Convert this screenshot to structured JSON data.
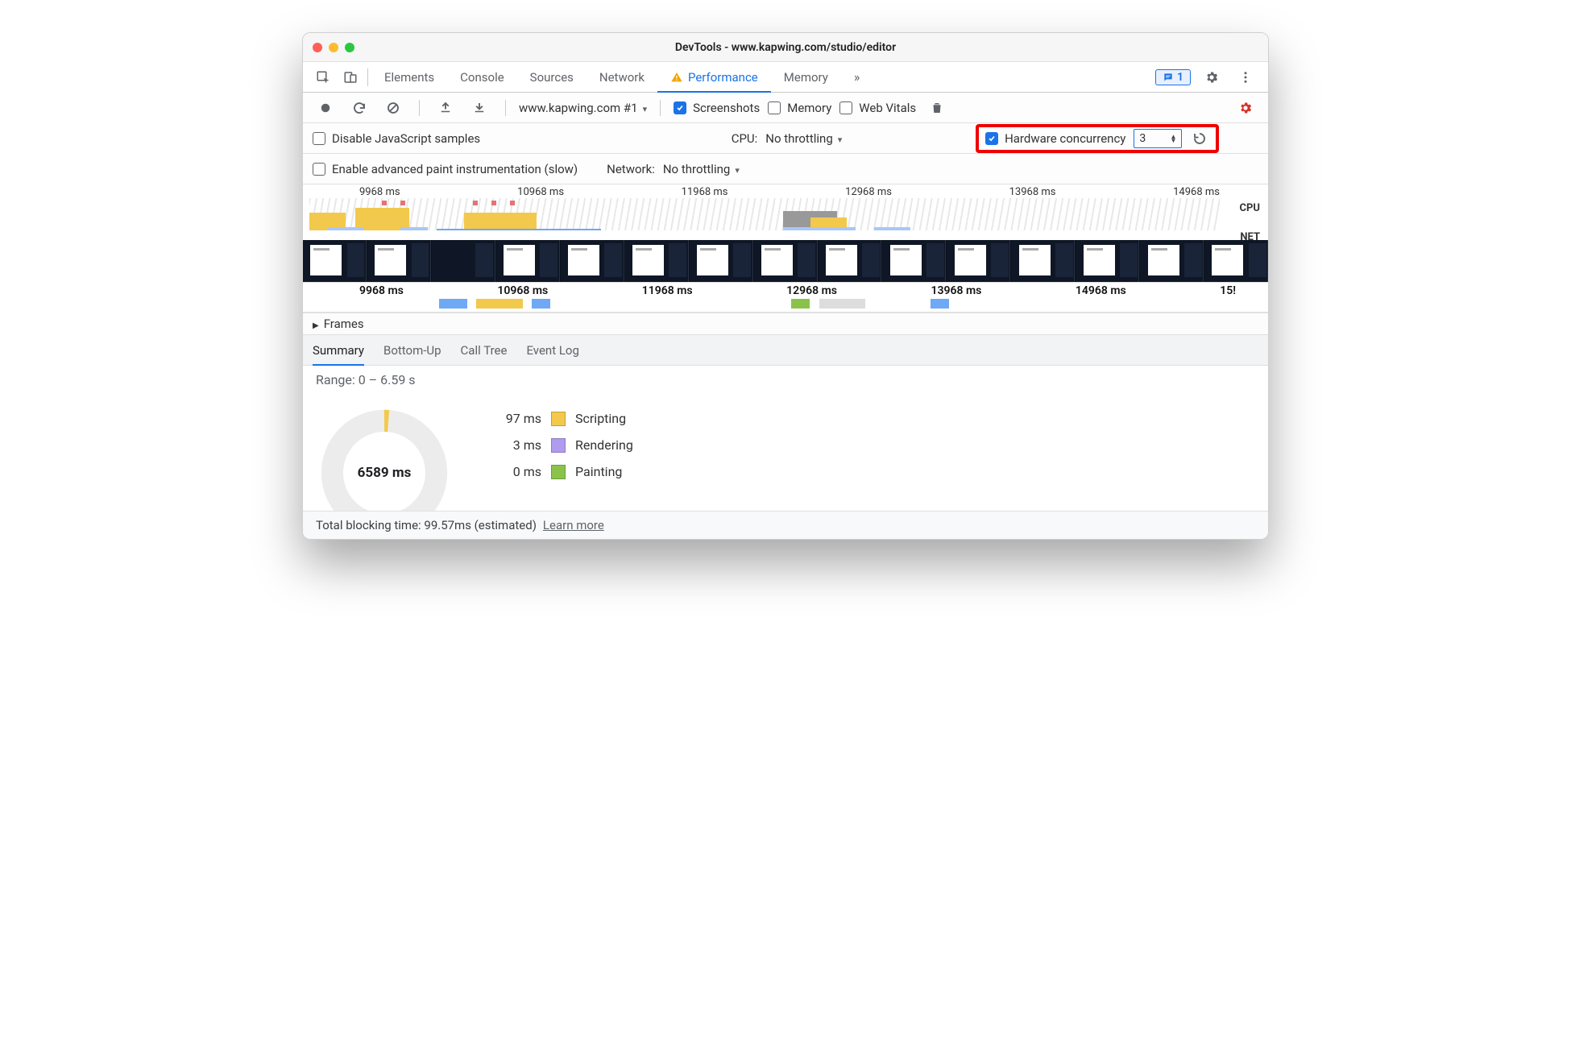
{
  "window": {
    "title": "DevTools - www.kapwing.com/studio/editor"
  },
  "tabs": {
    "items": [
      "Elements",
      "Console",
      "Sources",
      "Network",
      "Performance",
      "Memory"
    ],
    "active": "Performance",
    "badge_count": "1"
  },
  "toolbar": {
    "profile_label": "www.kapwing.com #1",
    "screenshots_label": "Screenshots",
    "memory_label": "Memory",
    "web_vitals_label": "Web Vitals"
  },
  "settings_row1": {
    "disable_js_label": "Disable JavaScript samples",
    "cpu_label": "CPU:",
    "cpu_value": "No throttling",
    "hw_conc_label": "Hardware concurrency",
    "hw_conc_value": "3"
  },
  "settings_row2": {
    "paint_label": "Enable advanced paint instrumentation (slow)",
    "network_label": "Network:",
    "network_value": "No throttling"
  },
  "overview": {
    "cpu_label": "CPU",
    "net_label": "NET",
    "ruler_ticks": [
      "9968 ms",
      "10968 ms",
      "11968 ms",
      "12968 ms",
      "13968 ms",
      "14968 ms"
    ],
    "track_ticks": [
      "9968 ms",
      "10968 ms",
      "11968 ms",
      "12968 ms",
      "13968 ms",
      "14968 ms",
      "15!"
    ]
  },
  "expander": {
    "frames_label": "Frames"
  },
  "summary": {
    "tabs": [
      "Summary",
      "Bottom-Up",
      "Call Tree",
      "Event Log"
    ],
    "range_label": "Range: 0 – 6.59 s",
    "donut_center": "6589 ms",
    "legend": [
      {
        "value": "97 ms",
        "label": "Scripting",
        "color": "#f2c94c"
      },
      {
        "value": "3 ms",
        "label": "Rendering",
        "color": "#af9cef"
      },
      {
        "value": "0 ms",
        "label": "Painting",
        "color": "#8bc34a"
      }
    ]
  },
  "footer": {
    "tbt_label": "Total blocking time: 99.57ms (estimated)",
    "learn_more": "Learn more"
  }
}
